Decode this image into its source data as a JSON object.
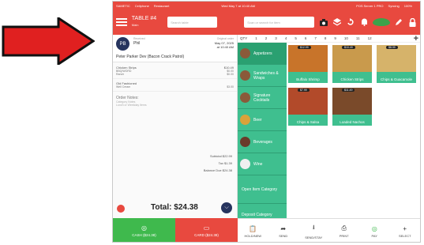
{
  "colors": {
    "brand_red": "#e8493f",
    "green": "#3fbf8f",
    "navy": "#26345e",
    "arrow": "#e02020"
  },
  "status": {
    "left": "SAMETIC",
    "signal": "Cellphone",
    "carrier": "Restaurant",
    "center": "Wed May 7 at 10:40 AM",
    "right1": "POS Server 1 PRO",
    "right2": "Syncing",
    "right3": "100%"
  },
  "header": {
    "table": "TABLE #4",
    "table_sub": "Main",
    "search_placeholder": "Search table",
    "item_search_placeholder": "Scan or search for item"
  },
  "ticket": {
    "received_label": "Received",
    "customer": "Phil",
    "order_label": "Original order",
    "order_date": "May 07, 2025",
    "order_time": "at 10:40 AM",
    "server": "Peter Parker Dev (Bacon Crack Patrol)",
    "lines": [
      {
        "name": "Chicken Strips",
        "price": "$10.49",
        "mod": false
      },
      {
        "name": "BBQ/WORD",
        "price": "$0.00",
        "mod": true
      },
      {
        "name": "Ranch",
        "price": "$0.00",
        "mod": true
      },
      {
        "name": "Old Fashioned",
        "price": "",
        "mod": false
      },
      {
        "name": "Well Cream",
        "price": "$3.00",
        "mod": true
      }
    ],
    "notes_label": "Order Notes:",
    "notes_sub1": "Category Notes",
    "notes_sub2": "Lunch or Weekday Items",
    "subtotal_label": "Subtotal",
    "subtotal": "$22.99",
    "tax_label": "Tax",
    "tax": "$1.39",
    "balance_label": "Balance Due",
    "balance": "$24.38",
    "total": "Total: $24.38"
  },
  "qty": {
    "label": "QTY",
    "numbers": [
      "1",
      "2",
      "3",
      "4",
      "5",
      "6",
      "7",
      "8",
      "9",
      "10",
      "11",
      "12"
    ],
    "plus": "+"
  },
  "categories": [
    "Appetizers",
    "Sandwiches & Wraps",
    "Signature Cocktails",
    "Beer",
    "Beverages",
    "Wine",
    "Open Item Category",
    "Deposit Category"
  ],
  "items": [
    {
      "name": "Buffalo Shrimp",
      "price": "$12.99"
    },
    {
      "name": "Chicken Strips",
      "price": "$10.49"
    },
    {
      "name": "Chips & Guacamole",
      "price": "$8.99"
    },
    {
      "name": "Chips & Salsa",
      "price": "$7.99"
    },
    {
      "name": "Loaded Nachos",
      "price": "$11.49"
    }
  ],
  "footer": {
    "cash": "CASH ($24.38)",
    "card": "CARD ($24.38)",
    "actions": [
      "HOLD/NEW",
      "SEND",
      "SEND/STAY",
      "PRINT",
      "PAY",
      "SELECT"
    ]
  }
}
